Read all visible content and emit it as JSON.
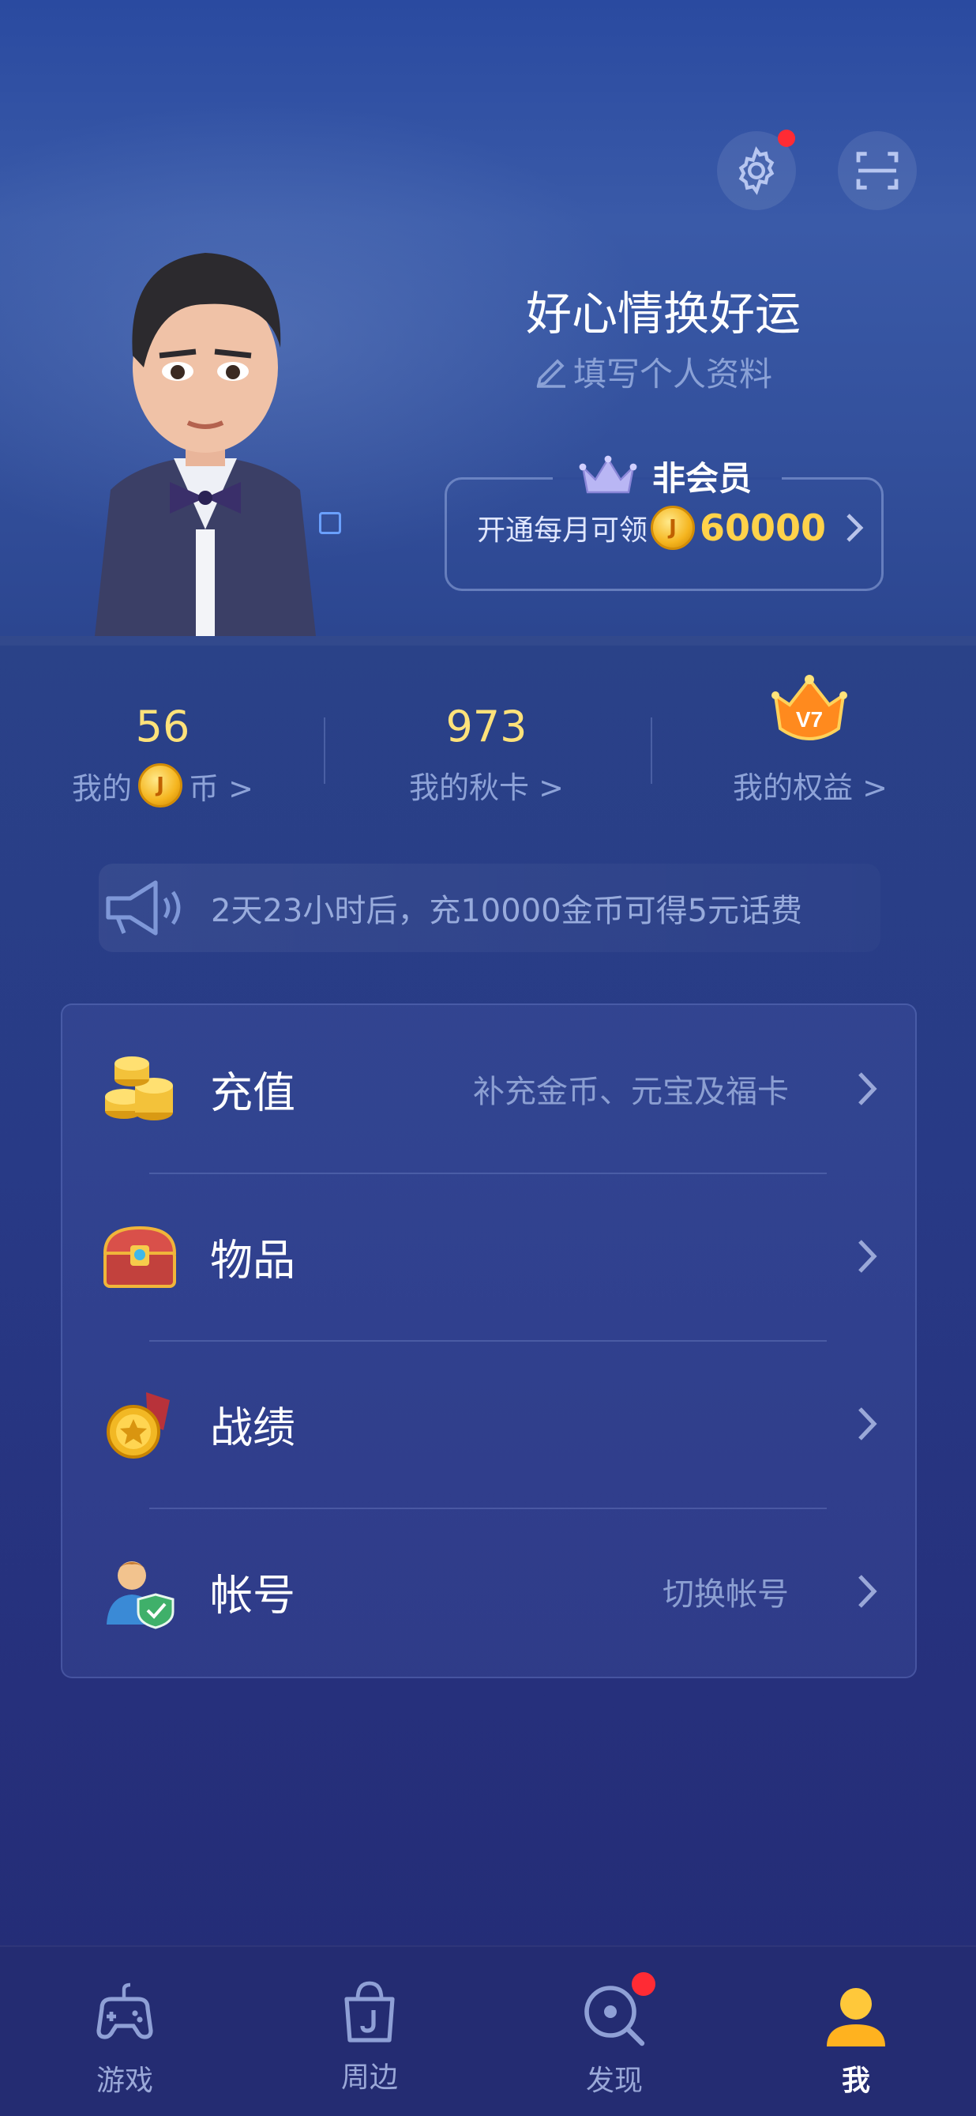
{
  "header": {
    "nickname": "好心情换好运",
    "edit_profile": "填写个人资料",
    "membership_title": "非会员",
    "membership_promo": "开通每月可领",
    "membership_gold": "60000",
    "settings_has_badge": true
  },
  "stats": {
    "coins_value": "56",
    "coins_label_prefix": "我的",
    "coins_label_suffix": "币 >",
    "autumn_cards_value": "973",
    "autumn_cards_label": "我的秋卡 >",
    "rights_badge": "V7",
    "rights_label": "我的权益 >"
  },
  "notice": {
    "text": "2天23小时后，充10000金币可得5元话费"
  },
  "menu": [
    {
      "label": "充值",
      "hint": "补充金币、元宝及福卡",
      "icon": "gold-coins-icon"
    },
    {
      "label": "物品",
      "hint": "",
      "icon": "treasure-chest-icon"
    },
    {
      "label": "战绩",
      "hint": "",
      "icon": "medal-icon"
    },
    {
      "label": "帐号",
      "hint": "切换帐号",
      "icon": "user-shield-icon"
    }
  ],
  "bottom_nav": [
    {
      "label": "游戏",
      "icon": "gamepad-icon",
      "active": false
    },
    {
      "label": "周边",
      "icon": "shopping-bag-icon",
      "active": false
    },
    {
      "label": "发现",
      "icon": "discover-icon",
      "active": false,
      "badge": true
    },
    {
      "label": "我",
      "icon": "profile-icon",
      "active": true
    }
  ],
  "colors": {
    "accent_gold": "#ffd24a",
    "stat_number": "#ffe27a",
    "badge_red": "#ff2b34",
    "background": "#283a86"
  }
}
